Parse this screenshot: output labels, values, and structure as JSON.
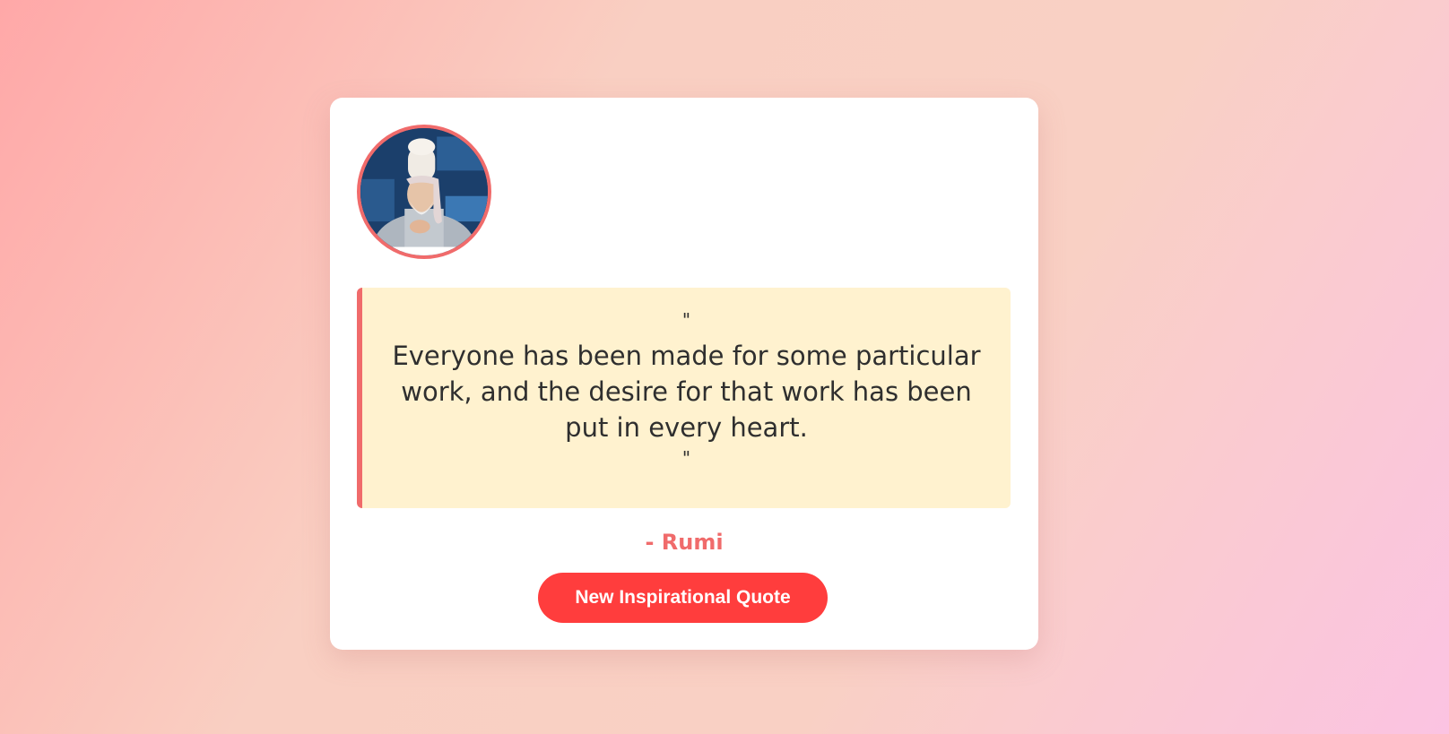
{
  "card": {
    "avatar_alt": "Rumi portrait"
  },
  "quote": {
    "open_mark": "\"",
    "text": "Everyone has been made for some particular work, and the desire for that work has been put in every heart.",
    "close_mark": "\""
  },
  "author": {
    "label": "- Rumi"
  },
  "button": {
    "label": "New Inspirational Quote"
  },
  "colors": {
    "accent": "#f06b6b",
    "button_bg": "#ff3d3d",
    "quote_bg": "#fff2cf"
  }
}
